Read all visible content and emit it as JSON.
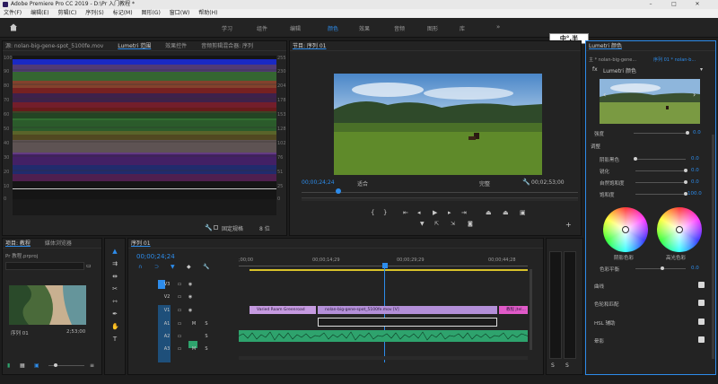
{
  "window": {
    "title": "Adobe Premiere Pro CC 2019 - D:\\Pr 入门教程 *",
    "controls": [
      "–",
      "□",
      "✕"
    ]
  },
  "menu": [
    "文件(F)",
    "编辑(E)",
    "剪辑(C)",
    "序列(S)",
    "标记(M)",
    "图形(G)",
    "窗口(W)",
    "帮助(H)"
  ],
  "workspaces": {
    "tabs": [
      "学习",
      "组件",
      "编辑",
      "颜色",
      "效果",
      "音频",
      "图形",
      "库"
    ],
    "active": "颜色"
  },
  "scope_panel": {
    "tabs": [
      "源: nolan-big-gene-spot_5100fe.mov",
      "Lumetri 范围",
      "效果控件",
      "音频剪辑混合器: 序列"
    ],
    "left_scale": [
      "100",
      "90",
      "80",
      "70",
      "60",
      "50",
      "40",
      "30",
      "20",
      "10",
      "0"
    ],
    "right_scale": [
      "255",
      "230",
      "204",
      "178",
      "153",
      "128",
      "102",
      "76",
      "51",
      "25",
      "0"
    ],
    "footer_label": "固定规格",
    "footer_select": "8 位"
  },
  "program_panel": {
    "tab": "节目: 序列 01",
    "timecode": "00;00;24;24",
    "fit": "适合",
    "quality": "完整",
    "duration": "00;02;53;00"
  },
  "lumetri": {
    "tab": "Lumetri 颜色",
    "source": "主 * nolan-big-gene...",
    "seq": "序列 01 * nolan-b...",
    "effect_label": "Lumetri 颜色",
    "brightness_label": "强度",
    "brightness_val": "0.0",
    "section_adjust": "调整",
    "rows": [
      {
        "label": "阴影黑色",
        "value": "0.0"
      },
      {
        "label": "锐化",
        "value": "0.0"
      },
      {
        "label": "自然饱和度",
        "value": "0.0"
      },
      {
        "label": "饱和度",
        "value": "100.0"
      }
    ],
    "wheel_shadow": "阴影色彩",
    "wheel_highlight": "高光色彩",
    "balance_label": "色彩平衡",
    "balance_val": "0.0",
    "sections": [
      "曲线",
      "色轮和匹配",
      "HSL 辅助",
      "晕影"
    ]
  },
  "project_panel": {
    "tabs": [
      "项目: 教程",
      "媒体浏览器"
    ],
    "search_placeholder": "Pr 教程.prproj",
    "item_name": "序列 01",
    "item_duration": "2;53;00"
  },
  "timeline": {
    "tab": "序列 01",
    "timecode": "00;00;24;24",
    "ruler": [
      ";00;00",
      "00;00;14;29",
      "00;00;29;29",
      "00;00;44;28"
    ],
    "video_tracks": [
      "V3",
      "V2",
      "V1"
    ],
    "audio_tracks": [
      "A1",
      "A2",
      "A3"
    ],
    "clip_v2_a": "Varied Roam Greenroad",
    "clip_v2_b": "nolan-big-gene-spot_5100fe.mov [V]",
    "clip_v2_c": "教程 jtel..."
  },
  "colors": {
    "accent": "#2d8ceb",
    "clip_video": "#c59ae0",
    "clip_audio": "#2ea36d",
    "playhead": "#2d8ceb"
  },
  "ime": "中°,半"
}
